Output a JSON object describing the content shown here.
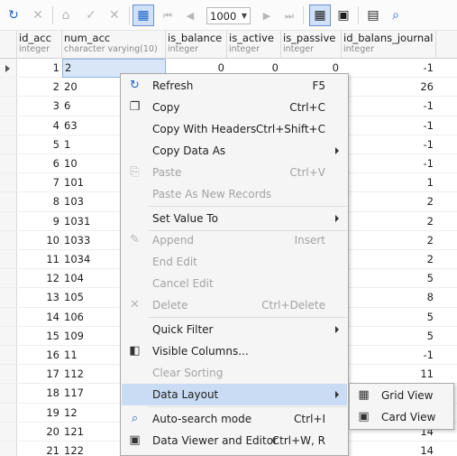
{
  "toolbar": {
    "page_size": "1000",
    "icons": [
      "refresh-icon",
      "cancel-icon",
      "post-icon",
      "apply-icon",
      "discard-icon",
      "grid-view-icon",
      "first-page-icon",
      "prev-page-icon",
      "next-page-icon",
      "last-page-icon",
      "grid-layout-icon",
      "card-layout-icon",
      "columns-icon",
      "autosearch-icon"
    ]
  },
  "columns": [
    {
      "name": "id_acc",
      "type": "integer"
    },
    {
      "name": "num_acc",
      "type": "character varying(10)"
    },
    {
      "name": "is_balance",
      "type": "integer"
    },
    {
      "name": "is_active",
      "type": "integer"
    },
    {
      "name": "is_passive",
      "type": "integer"
    },
    {
      "name": "id_balans_journal",
      "type": "integer"
    }
  ],
  "rows": [
    {
      "id_acc": "1",
      "num_acc": "2",
      "is_balance": "0",
      "is_active": "0",
      "is_passive": "0",
      "id_balans_journal": "-1"
    },
    {
      "id_acc": "2",
      "num_acc": "20",
      "id_balans_journal": "26"
    },
    {
      "id_acc": "3",
      "num_acc": "6",
      "id_balans_journal": "-1"
    },
    {
      "id_acc": "4",
      "num_acc": "63",
      "id_balans_journal": "-1"
    },
    {
      "id_acc": "5",
      "num_acc": "1",
      "id_balans_journal": "-1"
    },
    {
      "id_acc": "6",
      "num_acc": "10",
      "id_balans_journal": "-1"
    },
    {
      "id_acc": "7",
      "num_acc": "101",
      "id_balans_journal": "1"
    },
    {
      "id_acc": "8",
      "num_acc": "103",
      "id_balans_journal": "2"
    },
    {
      "id_acc": "9",
      "num_acc": "1031",
      "id_balans_journal": "2"
    },
    {
      "id_acc": "10",
      "num_acc": "1033",
      "id_balans_journal": "2"
    },
    {
      "id_acc": "11",
      "num_acc": "1034",
      "id_balans_journal": "2"
    },
    {
      "id_acc": "12",
      "num_acc": "104",
      "id_balans_journal": "5"
    },
    {
      "id_acc": "13",
      "num_acc": "105",
      "id_balans_journal": "8"
    },
    {
      "id_acc": "14",
      "num_acc": "106",
      "id_balans_journal": "5"
    },
    {
      "id_acc": "15",
      "num_acc": "109",
      "id_balans_journal": "5"
    },
    {
      "id_acc": "16",
      "num_acc": "11",
      "id_balans_journal": "-1"
    },
    {
      "id_acc": "17",
      "num_acc": "112",
      "id_balans_journal": "11"
    },
    {
      "id_acc": "18",
      "num_acc": "117",
      "id_balans_journal": ""
    },
    {
      "id_acc": "19",
      "num_acc": "12",
      "id_balans_journal": ""
    },
    {
      "id_acc": "20",
      "num_acc": "121",
      "id_balans_journal": "14"
    },
    {
      "id_acc": "21",
      "num_acc": "122",
      "id_balans_journal": "14"
    }
  ],
  "context_menu": {
    "refresh": {
      "label": "Refresh",
      "shortcut": "F5"
    },
    "copy": {
      "label": "Copy",
      "shortcut": "Ctrl+C"
    },
    "copy_headers": {
      "label": "Copy With Headers",
      "shortcut": "Ctrl+Shift+C"
    },
    "copy_data_as": {
      "label": "Copy Data As"
    },
    "paste": {
      "label": "Paste",
      "shortcut": "Ctrl+V"
    },
    "paste_new": {
      "label": "Paste As New Records"
    },
    "set_value": {
      "label": "Set Value To"
    },
    "append": {
      "label": "Append",
      "shortcut": "Insert"
    },
    "end_edit": {
      "label": "End Edit"
    },
    "cancel_edit": {
      "label": "Cancel Edit"
    },
    "delete": {
      "label": "Delete",
      "shortcut": "Ctrl+Delete"
    },
    "quick_filter": {
      "label": "Quick Filter"
    },
    "visible_columns": {
      "label": "Visible Columns..."
    },
    "clear_sorting": {
      "label": "Clear Sorting"
    },
    "data_layout": {
      "label": "Data Layout"
    },
    "autosearch": {
      "label": "Auto-search mode",
      "shortcut": "Ctrl+I"
    },
    "viewer": {
      "label": "Data Viewer and Editor",
      "shortcut": "Ctrl+W, R"
    }
  },
  "submenu": {
    "grid_view": {
      "label": "Grid View"
    },
    "card_view": {
      "label": "Card View"
    }
  },
  "colors": {
    "accent": "#1e64c8",
    "highlight": "#c9dcf3",
    "selected_cell": "#d8e6f8"
  }
}
